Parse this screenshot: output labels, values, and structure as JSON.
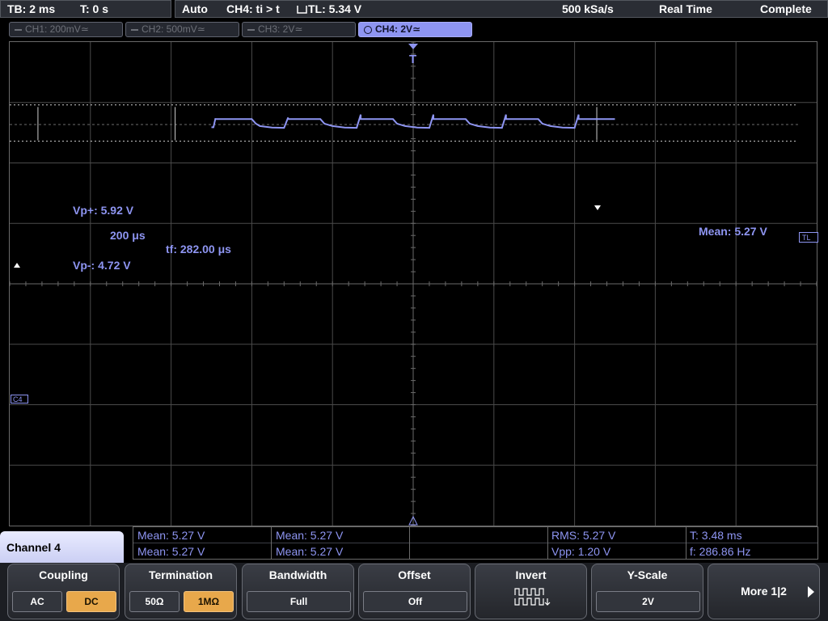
{
  "topbar": {
    "timebase": "TB: 2 ms",
    "time_offset": "T: 0 s",
    "trigger_mode": "Auto",
    "trigger_condition": "CH4: ti > t",
    "trigger_level": "TL:  5.34 V",
    "sample_rate": "500 kSa/s",
    "acq_mode": "Real Time",
    "acq_status": "Complete"
  },
  "channels": [
    {
      "label": "CH1: 200mV",
      "coupling_symbol": "≃"
    },
    {
      "label": "CH2: 500mV",
      "coupling_symbol": "≃"
    },
    {
      "label": "CH3: 2V",
      "coupling_symbol": "≃"
    },
    {
      "label": "CH4: 2V",
      "coupling_symbol": "≃",
      "active": true
    }
  ],
  "trigger_marker": "T",
  "cursors": {
    "vp_plus": "Vp+: 5.92 V",
    "vp_minus": "Vp-: 4.72 V",
    "tr_label": "200 μs",
    "tf_label": "tf: 282.00 μs",
    "mean_label": "Mean: 5.27 V"
  },
  "markers": {
    "channel_ground": "C4",
    "trigger_level": "TL"
  },
  "measurements": {
    "row1": [
      "Mean: 5.27 V",
      "Mean: 5.27 V",
      "",
      "RMS: 5.27 V",
      "T: 3.48 ms"
    ],
    "row2": [
      "Mean: 5.27 V",
      "Mean: 5.27 V",
      "",
      "Vpp: 1.20 V",
      "f: 286.86 Hz"
    ]
  },
  "menu": {
    "title": "Channel 4",
    "coupling": {
      "title": "Coupling",
      "options": [
        "AC",
        "DC"
      ],
      "selected": "DC"
    },
    "termination": {
      "title": "Termination",
      "options": [
        "50Ω",
        "1MΩ"
      ],
      "selected": "1MΩ"
    },
    "bandwidth": {
      "title": "Bandwidth",
      "value": "Full"
    },
    "offset": {
      "title": "Offset",
      "value": "Off"
    },
    "invert": {
      "title": "Invert"
    },
    "yscale": {
      "title": "Y-Scale",
      "value": "2V"
    },
    "more": {
      "label": "More 1|2"
    }
  },
  "colors": {
    "trace": "#8e95f2",
    "selected": "#e8a84b",
    "grid": "#555555"
  },
  "chart_data": {
    "type": "line",
    "series": [
      {
        "values": [
          [
            -5.0,
            5.18
          ],
          [
            -4.95,
            5.18
          ],
          [
            -4.9,
            5.48
          ],
          [
            -4.9,
            5.45
          ],
          [
            -4.0,
            5.45
          ],
          [
            -3.9,
            5.3
          ],
          [
            -3.8,
            5.22
          ],
          [
            -3.5,
            5.17
          ],
          [
            -3.2,
            5.16
          ],
          [
            -3.1,
            5.5
          ],
          [
            -3.1,
            5.45
          ],
          [
            -2.3,
            5.45
          ],
          [
            -2.2,
            5.3
          ],
          [
            -2.0,
            5.22
          ],
          [
            -1.7,
            5.17
          ],
          [
            -1.4,
            5.16
          ],
          [
            -1.3,
            5.6
          ],
          [
            -1.3,
            5.45
          ],
          [
            -0.5,
            5.45
          ],
          [
            -0.4,
            5.3
          ],
          [
            -0.2,
            5.22
          ],
          [
            0.1,
            5.17
          ],
          [
            0.4,
            5.16
          ],
          [
            0.5,
            5.6
          ],
          [
            0.5,
            5.45
          ],
          [
            1.3,
            5.45
          ],
          [
            1.4,
            5.3
          ],
          [
            1.6,
            5.22
          ],
          [
            1.9,
            5.17
          ],
          [
            2.2,
            5.16
          ],
          [
            2.3,
            5.6
          ],
          [
            2.3,
            5.45
          ],
          [
            3.1,
            5.45
          ],
          [
            3.2,
            5.3
          ],
          [
            3.4,
            5.22
          ],
          [
            3.7,
            5.17
          ],
          [
            4.0,
            5.16
          ],
          [
            4.1,
            5.6
          ],
          [
            4.1,
            5.45
          ],
          [
            5.0,
            5.45
          ]
        ]
      }
    ],
    "xlim": [
      -10,
      10
    ],
    "ylim": [
      -8,
      8
    ],
    "grid": true
  }
}
